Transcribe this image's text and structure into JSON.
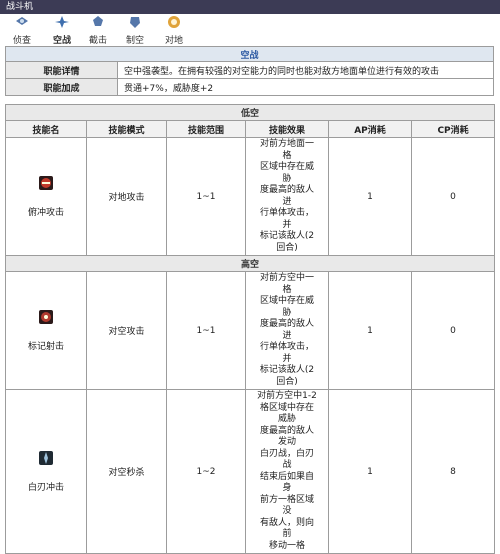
{
  "window": {
    "title": "战斗机"
  },
  "menu": [
    {
      "label": "侦查",
      "icon": "scout-icon"
    },
    {
      "label": "空战",
      "icon": "air-combat-icon"
    },
    {
      "label": "截击",
      "icon": "intercept-icon"
    },
    {
      "label": "制空",
      "icon": "air-superiority-icon"
    },
    {
      "label": "对地",
      "icon": "ground-attack-icon"
    }
  ],
  "info": {
    "header": "空战",
    "rows": [
      {
        "label": "职能详情",
        "value": "空中强袭型。在拥有较强的对空能力的同时也能对敌方地面单位进行有效的攻击"
      },
      {
        "label": "职能加成",
        "value": "贯通+7%，威胁度+2"
      }
    ]
  },
  "skills": {
    "sections": {
      "low": "低空",
      "high": "高空"
    },
    "columns": [
      "技能名",
      "技能模式",
      "技能范围",
      "技能效果",
      "AP消耗",
      "CP消耗"
    ],
    "rows": [
      {
        "name": "俯冲攻击",
        "mode": "对地攻击",
        "range": "1~1",
        "effect": [
          "对前方地面一格",
          "区域中存在威胁",
          "度最高的敌人进",
          "行单体攻击，并",
          "标记该敌人(2回合)"
        ],
        "ap": "1",
        "cp": "0",
        "icon": "dive-attack-icon",
        "color": "#c0392b"
      },
      {
        "name": "标记射击",
        "mode": "对空攻击",
        "range": "1~1",
        "effect": [
          "对前方空中一格",
          "区域中存在威胁",
          "度最高的敌人进",
          "行单体攻击，并",
          "标记该敌人(2回合)"
        ],
        "ap": "1",
        "cp": "0",
        "icon": "mark-shot-icon",
        "color": "#b03a2e"
      },
      {
        "name": "白刃冲击",
        "mode": "对空秒杀",
        "range": "1~2",
        "effect": [
          "对前方空中1-2",
          "格区域中存在威胁",
          "度最高的敌人发动",
          "白刃战，白刃战",
          "结束后如果自身",
          "前方一格区域没",
          "有敌人，则向前",
          "移动一格"
        ],
        "ap": "1",
        "cp": "8",
        "icon": "blade-charge-icon",
        "color": "#6d8fa8"
      }
    ]
  }
}
